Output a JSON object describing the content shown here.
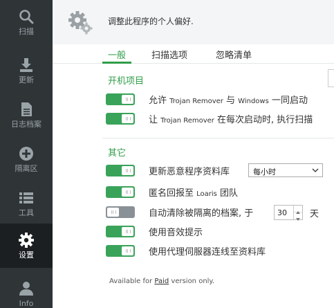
{
  "sidebar": {
    "items": [
      {
        "label": "扫描",
        "icon": "search-icon"
      },
      {
        "label": "更新",
        "icon": "download-icon"
      },
      {
        "label": "日志档案",
        "icon": "document-icon"
      },
      {
        "label": "隔离区",
        "icon": "plus-circle-icon"
      },
      {
        "label": "工具",
        "icon": "list-icon"
      },
      {
        "label": "设置",
        "icon": "gear-icon",
        "active": true
      },
      {
        "label": "Info",
        "icon": "user-icon"
      }
    ]
  },
  "header": {
    "description": "调整此程序的个人偏好.",
    "icon": "settings-gears-icon"
  },
  "tabs": [
    {
      "label": "一般",
      "active": true
    },
    {
      "label": "扫描选项"
    },
    {
      "label": "忽略清单"
    }
  ],
  "sections": {
    "startup": {
      "title": "开机项目",
      "options": [
        {
          "prefix": "允许 ",
          "small": "Trojan Remover",
          "suffix": " 与 ",
          "small2": "Windows",
          "suffix2": " 一同启动",
          "state": "on"
        },
        {
          "prefix": "让 ",
          "small": "Trojan Remover",
          "suffix": " 在每次启动时, 执行扫描",
          "state": "on"
        }
      ]
    },
    "other": {
      "title": "其它",
      "options": [
        {
          "label": "更新恶意程序资料库",
          "state": "on"
        },
        {
          "prefix": "匿名回报至 ",
          "small": "Loaris",
          "suffix": " 团队",
          "state": "on"
        },
        {
          "label": "自动清除被隔离的档案, 于",
          "state": "off"
        },
        {
          "label": "使用音效提示",
          "state": "on"
        },
        {
          "label": "使用代理伺服器连线至资料库",
          "state": "on"
        }
      ],
      "update_interval": "每小时",
      "purge_days": "30",
      "purge_unit": "天"
    }
  },
  "footer": {
    "prefix": "Available for ",
    "link": "Paid",
    "suffix": " version only."
  },
  "colors": {
    "accent": "#2f9d48",
    "sidebar_bg": "#2f3437",
    "sidebar_active": "#1b1f22",
    "toggle_on": "#3aa35a",
    "toggle_off": "#8a9196"
  }
}
